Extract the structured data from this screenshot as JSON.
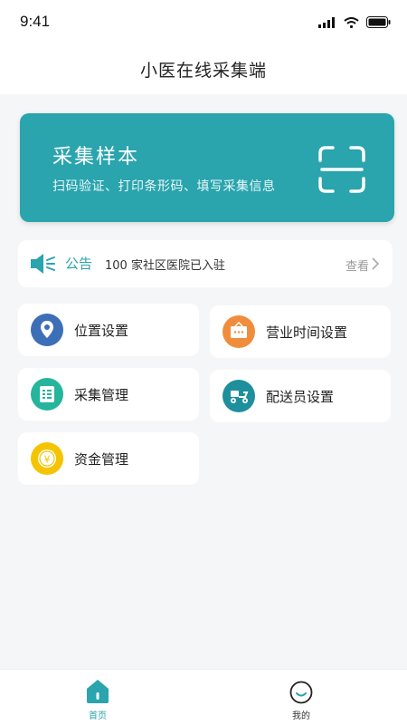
{
  "status_bar": {
    "time": "9:41"
  },
  "header": {
    "title": "小医在线采集端"
  },
  "banner": {
    "title": "采集样本",
    "subtitle": "扫码验证、打印条形码、填写采集信息",
    "icon": "scan-icon",
    "color": "#2aa4ad"
  },
  "notice": {
    "label": "公告",
    "text": "100 家社区医院已入驻",
    "more": "查看",
    "icon": "speaker-icon"
  },
  "menu": [
    {
      "label": "位置设置",
      "icon": "location-icon",
      "color": "#3d6fb8"
    },
    {
      "label": "营业时间设置",
      "icon": "shop-sign-icon",
      "color": "#f08d3c"
    },
    {
      "label": "采集管理",
      "icon": "list-icon",
      "color": "#24b59c"
    },
    {
      "label": "配送员设置",
      "icon": "scooter-icon",
      "color": "#1e8f9c"
    },
    {
      "label": "资金管理",
      "icon": "yuan-coin-icon",
      "color": "#f5c400"
    }
  ],
  "tabbar": {
    "active_color": "#2aa4ad",
    "items": [
      {
        "label": "首页",
        "icon": "home-icon",
        "active": true
      },
      {
        "label": "我的",
        "icon": "profile-icon",
        "active": false
      }
    ]
  }
}
